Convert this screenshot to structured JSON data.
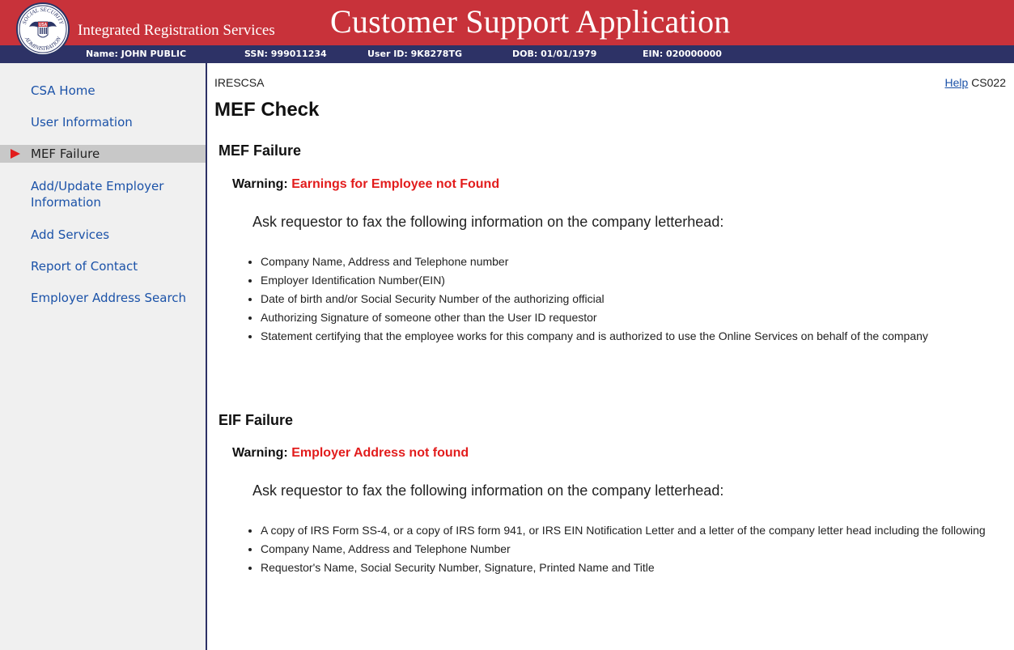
{
  "header": {
    "system_title": "Integrated Registration Services",
    "app_title": "Customer Support Application",
    "seal": {
      "ring_top": "SOCIAL SECURITY",
      "ring_bottom": "ADMINISTRATION",
      "shield": "USA"
    }
  },
  "infobar": {
    "name": "Name: JOHN PUBLIC",
    "ssn": "SSN: 999011234",
    "user_id": "User ID: 9K8278TG",
    "dob": "DOB: 01/01/1979",
    "ein": "EIN: 020000000"
  },
  "sidebar": {
    "items": [
      {
        "label": "CSA Home"
      },
      {
        "label": "User Information"
      },
      {
        "label": "MEF Failure",
        "active": true
      },
      {
        "label": "Add/Update Employer Information"
      },
      {
        "label": "Add Services"
      },
      {
        "label": "Report of Contact"
      },
      {
        "label": "Employer Address Search"
      }
    ]
  },
  "main": {
    "screen_code": "IRESCSA",
    "help_label": "Help",
    "page_id": "CS022",
    "page_title": "MEF Check",
    "sections": [
      {
        "title": "MEF Failure",
        "warning_label": "Warning:",
        "warning_message": "Earnings for Employee not Found",
        "instruction": "Ask requestor to fax the following information on the company letterhead:",
        "items": [
          "Company Name, Address and Telephone number",
          "Employer Identification Number(EIN)",
          "Date of birth and/or Social Security Number of the authorizing official",
          "Authorizing Signature of someone other than the User ID requestor",
          "Statement certifying that the employee works for this company and is authorized to use the Online Services on behalf of the company"
        ]
      },
      {
        "title": "EIF Failure",
        "warning_label": "Warning:",
        "warning_message": "Employer Address not found",
        "instruction": "Ask requestor to fax the following information on the company letterhead:",
        "items": [
          "A copy of IRS Form SS-4, or a copy of IRS form 941, or IRS EIN Notification Letter and a letter of the company letter head including the following",
          "Company Name, Address and Telephone Number",
          "Requestor's Name, Social Security Number, Signature, Printed Name and Title"
        ]
      }
    ]
  },
  "colors": {
    "header_red": "#c8323a",
    "infobar_navy": "#2d3266",
    "link_blue": "#1b52a8",
    "warning_red": "#e21c1c"
  }
}
